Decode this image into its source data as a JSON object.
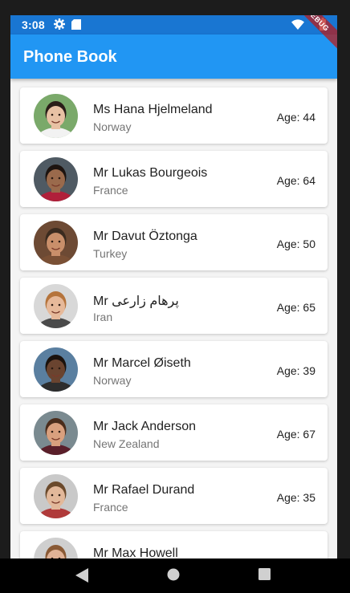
{
  "status": {
    "time": "3:08",
    "icons": [
      "gear-icon",
      "sd-card-icon",
      "wifi-icon",
      "battery-icon"
    ]
  },
  "app_bar": {
    "title": "Phone Book",
    "color": "#2196f3",
    "debug_banner": "DEBUG"
  },
  "contacts": [
    {
      "name": "Ms Hana Hjelmeland",
      "country": "Norway",
      "age": "Age: 44",
      "skin": "#e8c1a4",
      "hair": "#2a1d18",
      "bg": "#7aa96a",
      "shirt": "#f2f2f2"
    },
    {
      "name": "Mr Lukas Bourgeois",
      "country": "France",
      "age": "Age: 64",
      "skin": "#9a6a4c",
      "hair": "#1d1410",
      "bg": "#4f5a63",
      "shirt": "#b0203a"
    },
    {
      "name": "Mr Davut Öztonga",
      "country": "Turkey",
      "age": "Age: 50",
      "skin": "#c98f6a",
      "hair": "#3b2b1f",
      "bg": "#6d4a34",
      "shirt": "#7a5035"
    },
    {
      "name": "Mr پرهام زارعی",
      "country": "Iran",
      "age": "Age: 65",
      "skin": "#e6b99a",
      "hair": "#b5743c",
      "bg": "#d8d8d8",
      "shirt": "#4a4a4a"
    },
    {
      "name": "Mr Marcel Øiseth",
      "country": "Norway",
      "age": "Age: 39",
      "skin": "#6a4430",
      "hair": "#1b120d",
      "bg": "#5a7fa0",
      "shirt": "#2d2d2d"
    },
    {
      "name": "Mr Jack Anderson",
      "country": "New Zealand",
      "age": "Age: 67",
      "skin": "#d9a07e",
      "hair": "#4a2c1b",
      "bg": "#7a8a90",
      "shirt": "#5a1f2a"
    },
    {
      "name": "Mr Rafael Durand",
      "country": "France",
      "age": "Age: 35",
      "skin": "#e2b89a",
      "hair": "#6b4a2c",
      "bg": "#c9c9c9",
      "shirt": "#b03a3a"
    },
    {
      "name": "Mr Max Howell",
      "country": "",
      "age": "",
      "skin": "#e0b296",
      "hair": "#8a5a35",
      "bg": "#cfcfcf",
      "shirt": "#3a3a3a"
    }
  ],
  "nav": {
    "icons": [
      "back-icon",
      "home-icon",
      "recents-icon"
    ]
  }
}
